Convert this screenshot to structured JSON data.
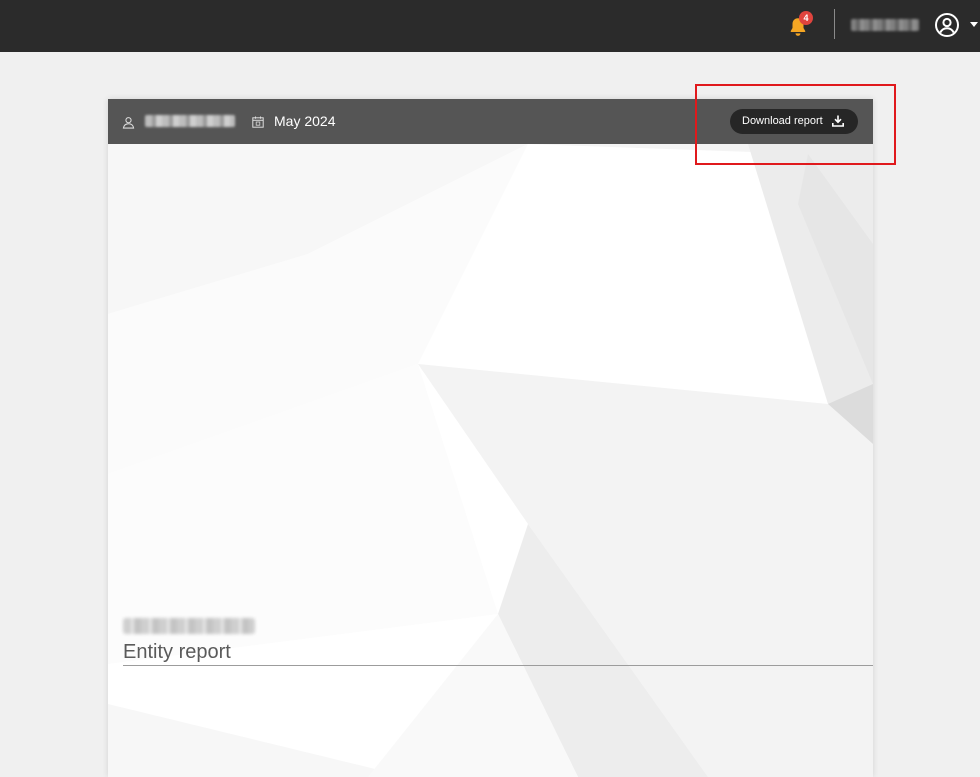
{
  "topbar": {
    "notifications": {
      "count": "4",
      "icon": "bell-icon",
      "color": "#f5a623"
    },
    "user_menu": {
      "icon": "user-circle-icon"
    }
  },
  "report": {
    "period": "May 2024",
    "download_label": "Download report",
    "subtitle": "Entity report"
  },
  "colors": {
    "topbar": "#2b2b2b",
    "card_header": "#555555",
    "button": "#262626",
    "badge": "#e0443e",
    "highlight": "#e0191c"
  }
}
